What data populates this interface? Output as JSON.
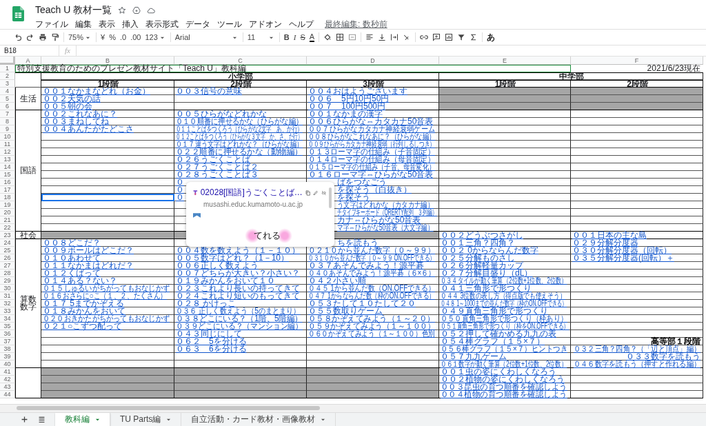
{
  "doc": {
    "title": "Teach U 教材一覧",
    "menu": [
      "ファイル",
      "編集",
      "表示",
      "挿入",
      "表示形式",
      "データ",
      "ツール",
      "アドオン",
      "ヘルプ"
    ],
    "last_edit": "最終編集: 数秒前"
  },
  "toolbar": {
    "zoom": "75%",
    "currency": "¥",
    "percent": "%",
    "decrease_decimal": ".0",
    "increase_decimal": ".00",
    "format": "123",
    "font": "Arial",
    "font_size": "11",
    "bold": "B",
    "italic": "I",
    "strike": "S",
    "text_color": "A",
    "input_tools": "あ"
  },
  "formula_bar": {
    "name_box": "B18",
    "fx": "fx"
  },
  "columns": [
    "A",
    "B",
    "C",
    "D",
    "E",
    "F"
  ],
  "row_numbers": [
    "1",
    "2",
    "3",
    "4",
    "5",
    "6",
    "7",
    "8",
    "9",
    "10",
    "11",
    "12",
    "13",
    "14",
    "15",
    "16",
    "17",
    "18",
    "19",
    "20",
    "21",
    "22",
    "23",
    "24",
    "25",
    "26",
    "27",
    "28",
    "29",
    "30",
    "31",
    "32",
    "33",
    "34",
    "35",
    "36",
    "37",
    "38",
    "39",
    "40",
    "41",
    "42",
    "43",
    "44"
  ],
  "title_row": {
    "title": "特別支援教育のためのプレゼン教材サイト「Teach U」教科編",
    "date": "2021/6/23現在"
  },
  "divisions": [
    {
      "label": "小学部",
      "stages": [
        "1段階",
        "2段階",
        "3段階"
      ]
    },
    {
      "label": "中学部",
      "stages": [
        "1段階",
        "2段階"
      ]
    }
  ],
  "subjects": [
    {
      "label": "生活",
      "rows": [
        [
          {
            "kind": "link",
            "text": "００１なかまなどれ（お金）"
          },
          {
            "kind": "link",
            "text": "００３信号の意味"
          },
          {
            "kind": "link",
            "text": "００４おはようございます"
          },
          {
            "kind": "shaded"
          },
          {
            "kind": "shaded"
          }
        ],
        [
          {
            "kind": "link",
            "text": "００２天気の話"
          },
          null,
          {
            "kind": "link",
            "text": "００６　5円10円50円"
          },
          {
            "kind": "shaded"
          },
          {
            "kind": "shaded"
          }
        ],
        [
          {
            "kind": "link",
            "text": "００５朝の会"
          },
          null,
          {
            "kind": "link",
            "text": "００７　100円500円"
          },
          {
            "kind": "shaded"
          },
          {
            "kind": "shaded"
          }
        ]
      ]
    },
    {
      "label": "国語",
      "rows": [
        [
          {
            "kind": "link",
            "text": "００２これなあに？"
          },
          {
            "kind": "link",
            "text": "００５ひらがなどれかな"
          },
          {
            "kind": "link",
            "text": "００１なかまの漢字"
          },
          null,
          null
        ],
        [
          {
            "kind": "link",
            "text": "００３まねしてね"
          },
          {
            "kind": "link",
            "text": "０１０順番に押せるかな（ひらがな編）"
          },
          {
            "kind": "link",
            "text": "００６ひらがな⇔カタカナ50音表"
          },
          null,
          null
        ],
        [
          {
            "kind": "link",
            "text": "００４あんたがたどこさ"
          },
          {
            "kind": "link",
            "text": "０１１ことばをつくろう（ひらがな2文字　あ、か行）"
          },
          {
            "kind": "link",
            "text": "００７ひらがなカタカナ神経衰弱ゲーム"
          },
          null,
          null
        ],
        [
          null,
          {
            "kind": "link",
            "text": "０１２ことばをつくろう（ひらがな３文字　か、さ、た行）"
          },
          {
            "kind": "link",
            "text": "００８ひらがなこれなあに？（ひらがな編）"
          },
          null,
          null
        ],
        [
          null,
          {
            "kind": "link",
            "text": "０１７違う文字はどれかな？（ひらがな編）"
          },
          {
            "kind": "link",
            "text": "００９ひらがらカタカナ神経衰弱（行列しるしつき）"
          },
          null,
          null
        ],
        [
          null,
          {
            "kind": "link",
            "text": "０２２順番に押せるかな（動物編）"
          },
          {
            "kind": "link",
            "text": "０１３ローマ字の仕組み（子音固定）"
          },
          null,
          null
        ],
        [
          null,
          {
            "kind": "link",
            "text": "０２６うごくことば"
          },
          {
            "kind": "link",
            "text": "０１４ローマ字の仕組み（母音固定）"
          },
          null,
          null
        ],
        [
          null,
          {
            "kind": "link",
            "text": "０２７うごくことば２"
          },
          {
            "kind": "link",
            "text": "０１５ローマ字の仕組み（子音、母音変化）"
          },
          null,
          null
        ],
        [
          null,
          {
            "kind": "link",
            "text": "０２８うごくことば３"
          },
          {
            "kind": "link",
            "text": "０１６ローマ字⇔ひらがな50音表"
          },
          null,
          null
        ],
        [
          null,
          {
            "kind": "link",
            "text": "０"
          },
          {
            "kind": "covered-link",
            "text": "ばをつなごう"
          },
          null,
          null
        ],
        [
          null,
          {
            "kind": "link",
            "text": "０"
          },
          {
            "kind": "covered-link",
            "text": "を探そう（白抜き）"
          },
          null,
          null
        ],
        [
          null,
          {
            "kind": "link",
            "text": "０"
          },
          {
            "kind": "covered-link",
            "text": "を探そう"
          },
          null,
          null
        ],
        [
          null,
          null,
          {
            "kind": "covered-link",
            "text": "う文字はどれかな（カタカナ編）"
          },
          null,
          null
        ],
        [
          null,
          null,
          {
            "kind": "covered-link",
            "text": "チタイプキーボード（QRERTY配列　３列編）"
          },
          null,
          null
        ],
        [
          null,
          null,
          {
            "kind": "covered-link",
            "text": "カナ⇔ひらがな50音表"
          },
          null,
          null
        ],
        [
          null,
          null,
          {
            "kind": "covered-link",
            "text": "マ字⇔ひらがな50音表（大文字編）"
          },
          null,
          null
        ]
      ]
    },
    {
      "label": "社会",
      "rows": [
        [
          {
            "kind": "shaded"
          },
          {
            "kind": "shaded"
          },
          {
            "kind": "shaded"
          },
          {
            "kind": "link",
            "text": "００２どうぶつさがし"
          },
          {
            "kind": "link",
            "text": "００１日本の主な島"
          }
        ]
      ]
    },
    {
      "label": "算数数字",
      "rows": [
        [
          {
            "kind": "link",
            "text": "００８どこだ？"
          },
          null,
          {
            "kind": "covered-link",
            "text": "ちを読もう"
          },
          {
            "kind": "link",
            "text": "００１三角？四角？"
          },
          {
            "kind": "link",
            "text": "０２９分解分度器"
          }
        ],
        [
          {
            "kind": "link",
            "text": "００９ボールはどこだ？"
          },
          {
            "kind": "link",
            "text": "００４数を数えよう（１－１０）"
          },
          {
            "kind": "link",
            "text": "０２１０から並んだ数字（０～９９）"
          },
          {
            "kind": "link",
            "text": "００２ 0からならんだ数字"
          },
          {
            "kind": "link",
            "text": "０３０分解分度器（回転）"
          }
        ],
        [
          {
            "kind": "link",
            "text": "０１０あわせて"
          },
          {
            "kind": "link",
            "text": "００５数字はどれ？（1－10）"
          },
          {
            "kind": "link",
            "text": "０３１０から並んだ数字（０～９９ ON.OFFできる）"
          },
          {
            "kind": "link",
            "text": "０２５分解ものさし"
          },
          {
            "kind": "link",
            "text": "０３５分解分度器(回転）＋"
          }
        ],
        [
          {
            "kind": "link",
            "text": "０１１なかまはどれだ？"
          },
          {
            "kind": "link",
            "text": "００６正しく数えよう"
          },
          {
            "kind": "link",
            "text": "０３７あそんでみよう！源平碁"
          },
          {
            "kind": "link",
            "text": "０２６分解軽量カップ"
          },
          null
        ],
        [
          {
            "kind": "link",
            "text": "０１２くばって"
          },
          {
            "kind": "link",
            "text": "００７どちらが大きい？小さい？"
          },
          {
            "kind": "link",
            "text": "０４０あそんでみよう！源平碁（６×６）"
          },
          {
            "kind": "link",
            "text": "０２７分解目盛り（dL）"
          },
          null
        ],
        [
          {
            "kind": "link",
            "text": "０１４ある？ない？"
          },
          {
            "kind": "link",
            "text": "０１９みかんをおいて１０"
          },
          {
            "kind": "link",
            "text": "０４２小さい順"
          },
          {
            "kind": "link",
            "text": "０３４タイルが動く筆算（2位数+1位数、2位数）"
          },
          null
        ],
        [
          {
            "kind": "link",
            "text": "０１５しゅるいがちがってもおなじかず"
          },
          {
            "kind": "link",
            "text": "０２３これより長いの持ってきて"
          },
          {
            "kind": "link",
            "text": "０４５ 1から並んだ数（ON.OFFできる）"
          },
          {
            "kind": "link",
            "text": "０４１三角形で形つくり"
          },
          null
        ],
        [
          {
            "kind": "link",
            "text": "０１６おさらに○こ（１、２、たくさん）"
          },
          {
            "kind": "link",
            "text": "０２４これより短いのもってきて"
          },
          {
            "kind": "link",
            "text": "０４７ 1からならんだ数（枠のON.OFFできる）"
          },
          {
            "kind": "link",
            "text": "０４４ 3位数の表し方（得点版でも使えそう）"
          },
          null
        ],
        [
          {
            "kind": "link",
            "text": "０１７ 5までかぞえる"
          },
          {
            "kind": "link",
            "text": "０２８ かけっこ"
          },
          {
            "kind": "link",
            "text": "０５３たして１０たして２０"
          },
          {
            "kind": "link",
            "text": "０４８ 1～1000までの並んだ数字（枠のON.OFFできる）"
          },
          null
        ],
        [
          {
            "kind": "link",
            "text": "０１８みかんをおいて"
          },
          {
            "kind": "link",
            "text": "０３６ 正しく数えよう（5のまとまり）"
          },
          {
            "kind": "link",
            "text": "０５５数取りゲーム"
          },
          {
            "kind": "link",
            "text": "０４９直角三角形で形つくり"
          },
          null
        ],
        [
          {
            "kind": "link",
            "text": "０２０おきかたがちがってもおなじかず"
          },
          {
            "kind": "link",
            "text": "０３８どこにいる？（1階、5階編）"
          },
          {
            "kind": "link",
            "text": "０５８かぞえてみよう（１～２０）"
          },
          {
            "kind": "link",
            "text": "０５０直角三角形で形つくり（枠あり）"
          },
          null
        ],
        [
          {
            "kind": "link",
            "text": "０２１○こずつ配って"
          },
          {
            "kind": "link",
            "text": "０３９どこにいる？（マンション編）"
          },
          {
            "kind": "link",
            "text": "０５９かぞえてみよう（１～１００）"
          },
          {
            "kind": "link",
            "text": "０５１直角三角形で形つくり（枠をON.OFFできる）"
          },
          null
        ],
        [
          null,
          {
            "kind": "link",
            "text": "０４３同じにして"
          },
          {
            "kind": "link",
            "text": "０６０かぞえてみよう（１～１００）色別"
          },
          {
            "kind": "link",
            "text": "０５２押して確かめる九九の表"
          },
          null
        ],
        [
          null,
          {
            "kind": "link",
            "text": "０６２　5を分ける"
          },
          null,
          {
            "kind": "link",
            "text": "０５４棒グラフ（１５×７）"
          },
          {
            "kind": "heading",
            "text": "高等部１段階"
          }
        ],
        [
          null,
          {
            "kind": "link",
            "text": "０６３　6を分ける"
          },
          null,
          {
            "kind": "link",
            "text": "０５６棒グラフ（１５×７）ヒントつき"
          },
          {
            "kind": "right-link",
            "text": "０３２三角？四角？（「辺と頂点」編）"
          }
        ],
        [
          null,
          null,
          null,
          {
            "kind": "link",
            "text": "０５７九九ゲーム"
          },
          {
            "kind": "right-link",
            "text": "０３３数字を読もう"
          }
        ],
        [
          null,
          null,
          null,
          {
            "kind": "link",
            "text": "０６１数字が動く筆算（2位数+1位数、2位数）"
          },
          {
            "kind": "right-link",
            "text": "０４６数字を読もう（押すと作れる編）"
          }
        ]
      ]
    },
    {
      "rows": [
        [
          {
            "kind": "shaded"
          },
          {
            "kind": "shaded"
          },
          {
            "kind": "shaded"
          },
          {
            "kind": "link",
            "text": "００１虫の姿にくわしくなろう"
          },
          null
        ],
        [
          {
            "kind": "shaded"
          },
          {
            "kind": "shaded"
          },
          {
            "kind": "shaded"
          },
          {
            "kind": "link",
            "text": "００２植物の姿にくわしくなろう"
          },
          null
        ],
        [
          {
            "kind": "shaded"
          },
          {
            "kind": "shaded"
          },
          {
            "kind": "shaded"
          },
          {
            "kind": "link",
            "text": "００３昆虫の育つ順番を確認しよう"
          },
          null
        ],
        [
          {
            "kind": "shaded"
          },
          {
            "kind": "shaded"
          },
          {
            "kind": "shaded"
          },
          {
            "kind": "link",
            "text": "００４植物の育つ順番を確認しよう"
          },
          null
        ]
      ]
    }
  ],
  "link_popup": {
    "title": "02028[国語]うごくことば…",
    "url": "musashi.educ.kumamoto-u.ac.jp",
    "preview_text": "てれる"
  },
  "sheet_tabs": [
    {
      "label": "教科編",
      "selected": true
    },
    {
      "label": "TU Parts編",
      "selected": false
    },
    {
      "label": "自立活動・カード教材・画像教材",
      "selected": false
    }
  ]
}
